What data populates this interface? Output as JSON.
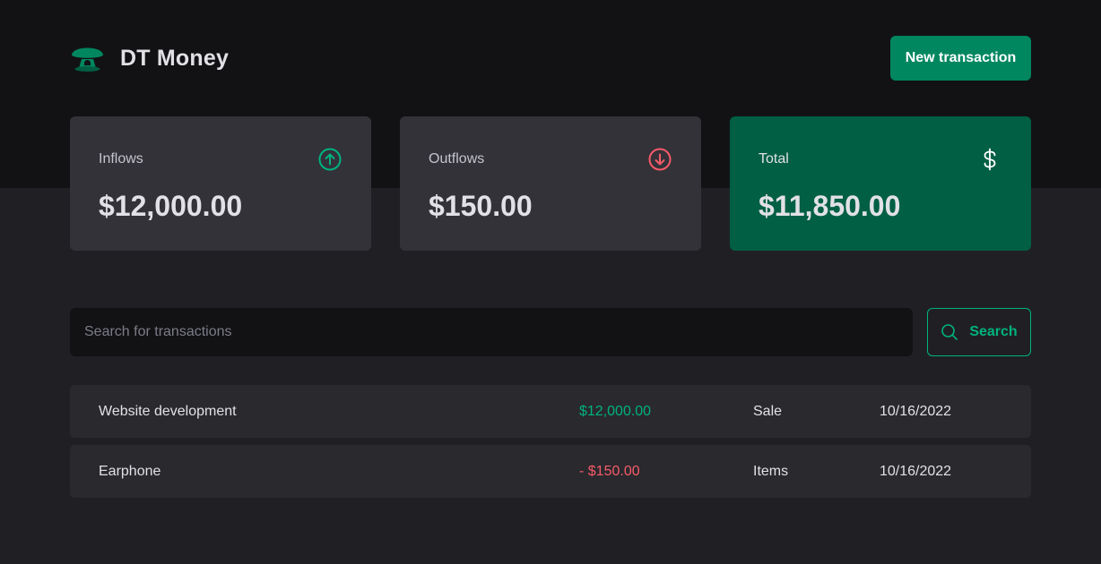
{
  "colors": {
    "background": "#202024",
    "header_background": "#121214",
    "card": "#323238",
    "total_card": "#015f43",
    "primary_button": "#00875f",
    "income": "#00b37e",
    "outcome": "#f75a68"
  },
  "header": {
    "logo_icon": "mushroom-logo-icon",
    "brand_name": "DT Money",
    "new_transaction_label": "New transaction"
  },
  "summary": {
    "inflows": {
      "label": "Inflows",
      "value": "$12,000.00",
      "icon": "arrow-circle-up-icon"
    },
    "outflows": {
      "label": "Outflows",
      "value": "$150.00",
      "icon": "arrow-circle-down-icon"
    },
    "total": {
      "label": "Total",
      "value": "$11,850.00",
      "icon": "dollar-sign-icon"
    }
  },
  "search": {
    "placeholder": "Search for transactions",
    "value": "",
    "button_label": "Search",
    "icon": "magnifying-glass-icon"
  },
  "transactions": [
    {
      "description": "Website development",
      "price": "$12,000.00",
      "type": "income",
      "category": "Sale",
      "date": "10/16/2022"
    },
    {
      "description": "Earphone",
      "price": "- $150.00",
      "type": "outcome",
      "category": "Items",
      "date": "10/16/2022"
    }
  ]
}
